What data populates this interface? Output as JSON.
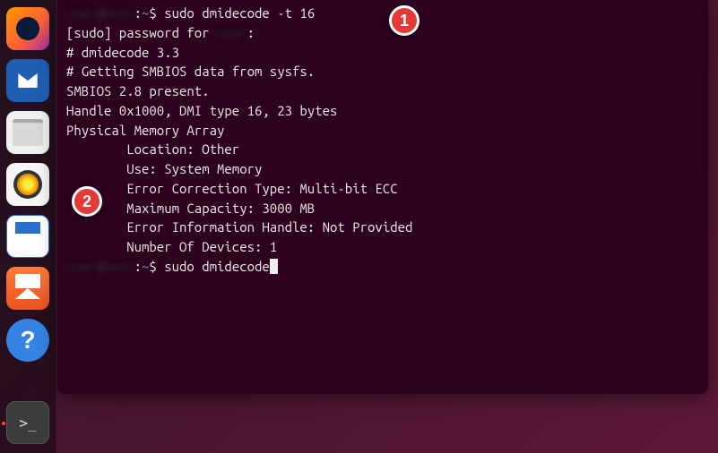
{
  "dock": {
    "items": [
      {
        "name": "firefox-icon"
      },
      {
        "name": "thunderbird-icon"
      },
      {
        "name": "files-icon"
      },
      {
        "name": "rhythmbox-icon"
      },
      {
        "name": "libreoffice-writer-icon"
      },
      {
        "name": "ubuntu-software-icon"
      },
      {
        "name": "help-icon"
      },
      {
        "name": "terminal-icon"
      }
    ]
  },
  "callouts": {
    "one": "1",
    "two": "2"
  },
  "terminal": {
    "prompt1": {
      "sep": ":",
      "path": "~",
      "dollar": "$",
      "cmd": "sudo dmidecode -t 16"
    },
    "lines": {
      "sudo_pw_prefix": "[sudo] password for ",
      "sudo_pw_suffix": ":",
      "ver": "# dmidecode 3.3",
      "get": "# Getting SMBIOS data from sysfs.",
      "smb": "SMBIOS 2.8 present.",
      "blank1": "",
      "handle": "Handle 0x1000, DMI type 16, 23 bytes",
      "pma": "Physical Memory Array",
      "loc": "        Location: Other",
      "use": "        Use: System Memory",
      "ect": "        Error Correction Type: Multi-bit ECC",
      "maxcap": "        Maximum Capacity: 3000 MB",
      "eih": "        Error Information Handle: Not Provided",
      "nod": "        Number Of Devices: 1",
      "blank2": ""
    },
    "prompt2": {
      "sep": ":",
      "path": "~",
      "dollar": "$",
      "cmd": "sudo dmidecode"
    }
  }
}
